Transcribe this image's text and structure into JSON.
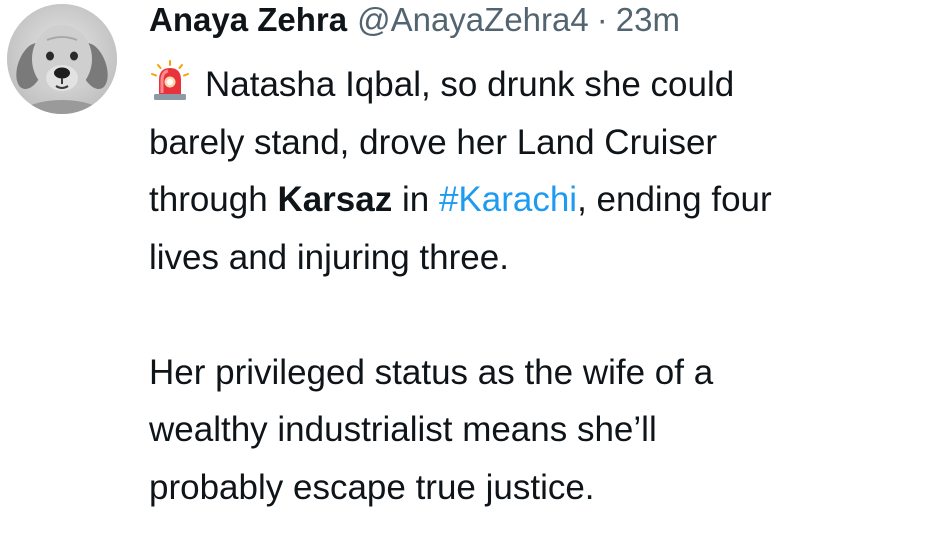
{
  "tweet": {
    "author": {
      "display_name": "Anaya Zehra",
      "handle": "@AnayaZehra4",
      "separator": "·",
      "time": "23m",
      "avatar_icon": "dog-avatar-icon"
    },
    "body": {
      "emoji_icon": "police-light-icon",
      "p1": {
        "line1": "Natasha Iqbal, so drunk she could",
        "line2": "barely stand, drove her Land Cruiser",
        "line3_pre": "through ",
        "line3_bold": "Karsaz",
        "line3_mid": " in ",
        "line3_hashtag": "#Karachi",
        "line3_post": ", ending four",
        "line4": "lives and injuring three."
      },
      "p2": {
        "line1": "Her privileged status as the wife of a",
        "line2": "wealthy industrialist means she’ll",
        "line3": "probably escape true justice."
      }
    },
    "colors": {
      "text": "#0f1419",
      "secondary": "#536471",
      "hashtag": "#1d9bf0"
    }
  }
}
